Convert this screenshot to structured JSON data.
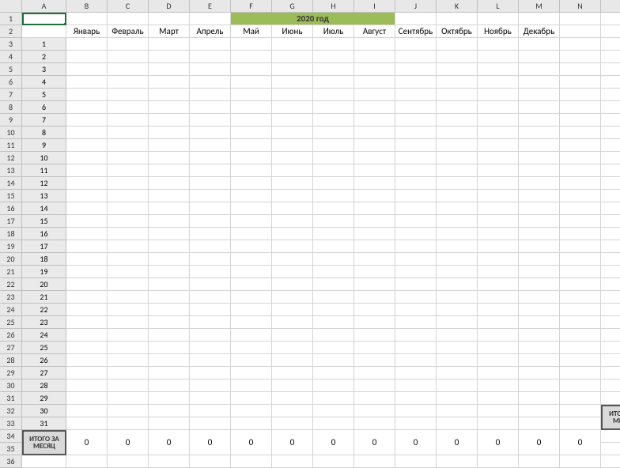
{
  "columns": [
    "A",
    "B",
    "C",
    "D",
    "E",
    "F",
    "G",
    "H",
    "I",
    "J",
    "K",
    "L",
    "M",
    "N"
  ],
  "title": "2020 год",
  "months": [
    "Январь",
    "Февраль",
    "Март",
    "Апрель",
    "Май",
    "Июнь",
    "Июль",
    "Август",
    "Сентябрь",
    "Октябрь",
    "Ноябрь",
    "Декабрь"
  ],
  "day_count": 31,
  "totals_label": "ИТОГО ЗА МЕСЯЦ",
  "monthly_totals": [
    0,
    0,
    0,
    0,
    0,
    0,
    0,
    0,
    0,
    0,
    0,
    0,
    0
  ],
  "row_numbers": 36
}
